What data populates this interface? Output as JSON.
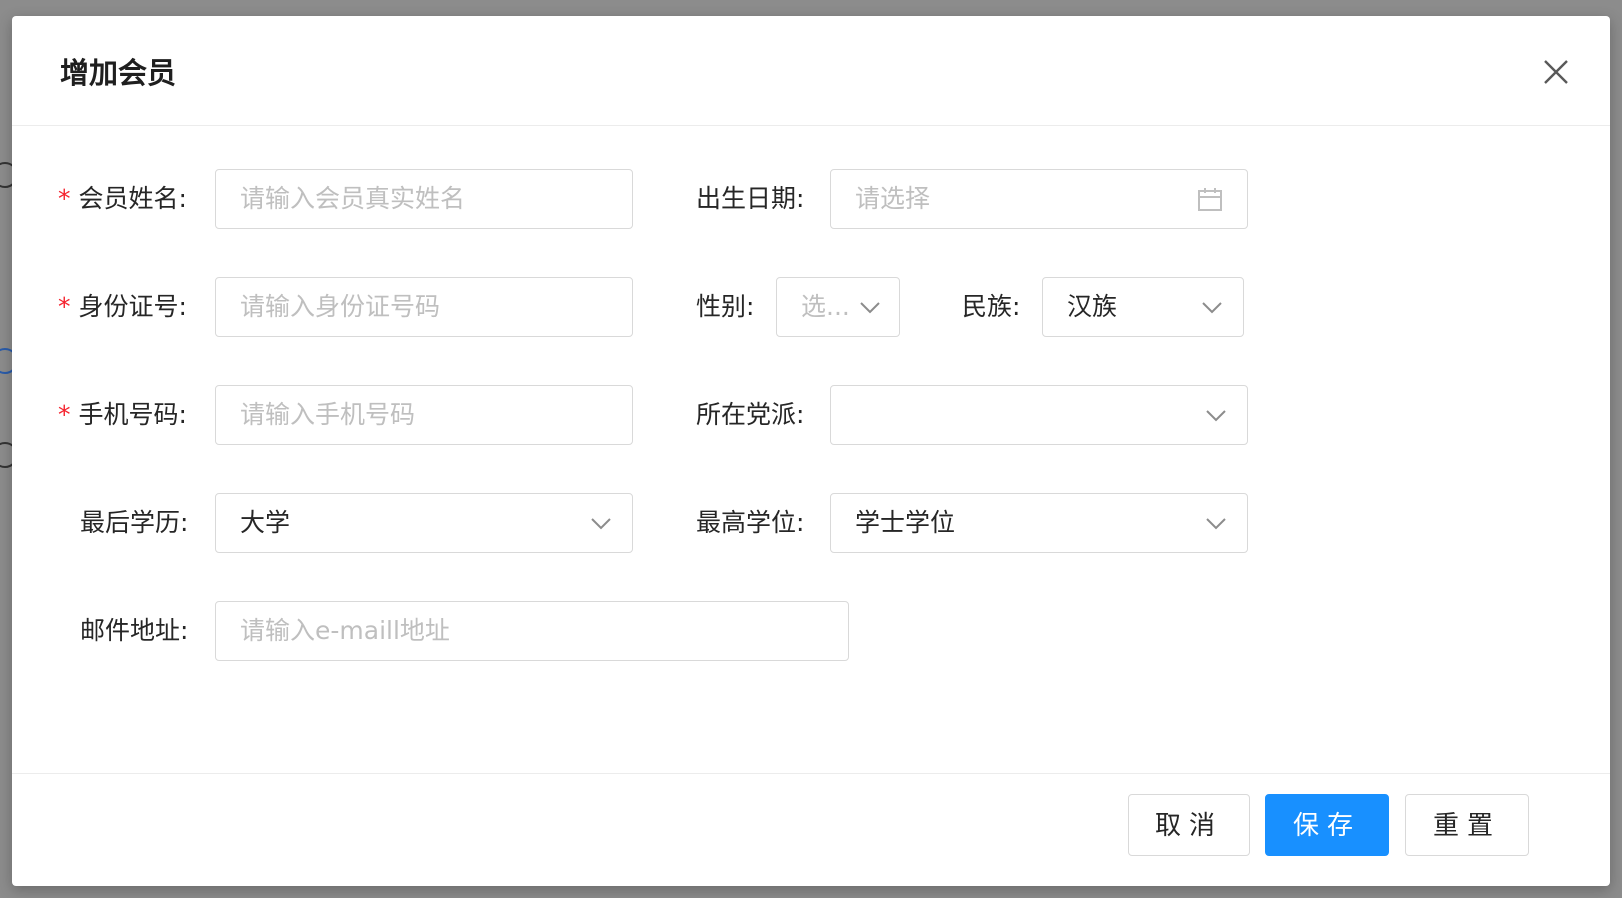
{
  "modal": {
    "title": "增加会员"
  },
  "form": {
    "name": {
      "label": "会员姓名:",
      "placeholder": "请输入会员真实姓名",
      "required": true
    },
    "birth_date": {
      "label": "出生日期:",
      "placeholder": "请选择"
    },
    "id_number": {
      "label": "身份证号:",
      "placeholder": "请输入身份证号码",
      "required": true
    },
    "gender": {
      "label": "性别:",
      "placeholder": "选..."
    },
    "ethnicity": {
      "label": "民族:",
      "value": "汉族"
    },
    "phone": {
      "label": "手机号码:",
      "placeholder": "请输入手机号码",
      "required": true
    },
    "party": {
      "label": "所在党派:",
      "value": ""
    },
    "education": {
      "label": "最后学历:",
      "value": "大学"
    },
    "degree": {
      "label": "最高学位:",
      "value": "学士学位"
    },
    "email": {
      "label": "邮件地址:",
      "placeholder": "请输入e-maill地址"
    },
    "required_mark": "*"
  },
  "footer": {
    "cancel_label": "取消",
    "save_label": "保存",
    "reset_label": "重置"
  },
  "colors": {
    "primary": "#1890ff",
    "required": "#f5222d",
    "border": "#d9d9d9",
    "placeholder": "#bfbfbf",
    "overlay": "#8c8c8c"
  },
  "icons": {
    "close": "close-icon",
    "calendar": "calendar-icon",
    "dropdown": "chevron-down-icon"
  }
}
